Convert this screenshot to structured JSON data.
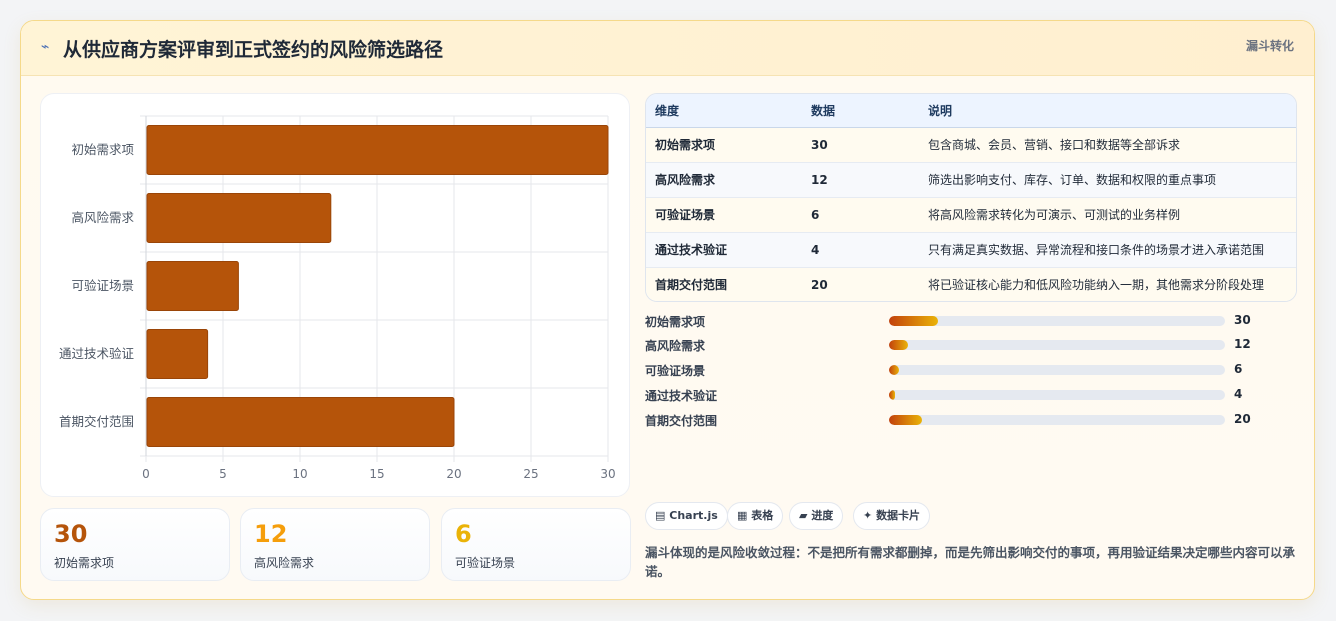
{
  "header": {
    "icon": "sparkline-icon",
    "title": "从供应商方案评审到正式签约的风险筛选路径",
    "tag": "漏斗转化"
  },
  "chart_data": {
    "type": "bar",
    "orientation": "horizontal",
    "categories": [
      "初始需求项",
      "高风险需求",
      "可验证场景",
      "通过技术验证",
      "首期交付范围"
    ],
    "values": [
      30,
      12,
      6,
      4,
      20
    ],
    "xlim": [
      0,
      30
    ],
    "xticks": [
      "0",
      "5",
      "10",
      "15",
      "20",
      "25",
      "30"
    ],
    "title": "",
    "xlabel": "",
    "ylabel": "",
    "bar_color": "#b5540a",
    "grid": true
  },
  "kpis": [
    {
      "value": "30",
      "label": "初始需求项",
      "color": "#b5540a"
    },
    {
      "value": "12",
      "label": "高风险需求",
      "color": "#f59e0b"
    },
    {
      "value": "6",
      "label": "可验证场景",
      "color": "#eab308"
    }
  ],
  "table": {
    "headers": [
      "维度",
      "数据",
      "说明"
    ],
    "rows": [
      [
        "初始需求项",
        "30",
        "包含商城、会员、营销、接口和数据等全部诉求"
      ],
      [
        "高风险需求",
        "12",
        "筛选出影响支付、库存、订单、数据和权限的重点事项"
      ],
      [
        "可验证场景",
        "6",
        "将高风险需求转化为可演示、可测试的业务样例"
      ],
      [
        "通过技术验证",
        "4",
        "只有满足真实数据、异常流程和接口条件的场景才进入承诺范围"
      ],
      [
        "首期交付范围",
        "20",
        "将已验证核心能力和低风险功能纳入一期，其他需求分阶段处理"
      ]
    ]
  },
  "progress": [
    {
      "label": "初始需求项",
      "value": "30",
      "pct": 14.6
    },
    {
      "label": "高风险需求",
      "value": "12",
      "pct": 5.8
    },
    {
      "label": "可验证场景",
      "value": "6",
      "pct": 2.9
    },
    {
      "label": "通过技术验证",
      "value": "4",
      "pct": 1.9
    },
    {
      "label": "首期交付范围",
      "value": "20",
      "pct": 9.7
    }
  ],
  "chips": [
    {
      "icon": "chart-icon",
      "glyph": "▤",
      "label": "Chart.js"
    },
    {
      "icon": "table-icon",
      "glyph": "▦",
      "label": "表格"
    },
    {
      "icon": "progress-icon",
      "glyph": "▰",
      "label": "进度"
    },
    {
      "icon": "sparkle-icon",
      "glyph": "✦",
      "label": "数据卡片"
    }
  ],
  "note": "漏斗体现的是风险收敛过程：不是把所有需求都删掉，而是先筛出影响交付的事项，再用验证结果决定哪些内容可以承诺。"
}
